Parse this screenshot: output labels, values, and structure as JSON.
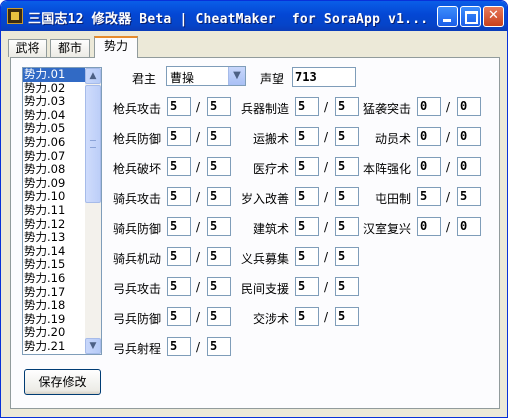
{
  "window": {
    "title": "三国志12 修改器 Beta | CheatMaker  for SoraApp v1...",
    "minimize_icon": "minimize-icon",
    "maximize_icon": "maximize-icon",
    "close_icon": "close-icon"
  },
  "tabs": [
    {
      "label": "武将"
    },
    {
      "label": "都市"
    },
    {
      "label": "势力",
      "active": true
    }
  ],
  "faction_list": {
    "items": [
      "势力.01",
      "势力.02",
      "势力.03",
      "势力.04",
      "势力.05",
      "势力.06",
      "势力.07",
      "势力.08",
      "势力.09",
      "势力.10",
      "势力.11",
      "势力.12",
      "势力.13",
      "势力.14",
      "势力.15",
      "势力.16",
      "势力.17",
      "势力.18",
      "势力.19",
      "势力.20",
      "势力.21"
    ],
    "selected_index": 0
  },
  "lord": {
    "label": "君主",
    "value": "曹操"
  },
  "fame": {
    "label": "声望",
    "value": "713"
  },
  "col1": [
    {
      "label": "枪兵攻击",
      "cur": "5",
      "max": "5"
    },
    {
      "label": "枪兵防御",
      "cur": "5",
      "max": "5"
    },
    {
      "label": "枪兵破坏",
      "cur": "5",
      "max": "5"
    },
    {
      "label": "骑兵攻击",
      "cur": "5",
      "max": "5"
    },
    {
      "label": "骑兵防御",
      "cur": "5",
      "max": "5"
    },
    {
      "label": "骑兵机动",
      "cur": "5",
      "max": "5"
    },
    {
      "label": "弓兵攻击",
      "cur": "5",
      "max": "5"
    },
    {
      "label": "弓兵防御",
      "cur": "5",
      "max": "5"
    },
    {
      "label": "弓兵射程",
      "cur": "5",
      "max": "5"
    }
  ],
  "col2": [
    {
      "label": "兵器制造",
      "cur": "5",
      "max": "5"
    },
    {
      "label": "运搬术",
      "cur": "5",
      "max": "5"
    },
    {
      "label": "医疗术",
      "cur": "5",
      "max": "5"
    },
    {
      "label": "岁入改善",
      "cur": "5",
      "max": "5"
    },
    {
      "label": "建筑术",
      "cur": "5",
      "max": "5"
    },
    {
      "label": "义兵募集",
      "cur": "5",
      "max": "5"
    },
    {
      "label": "民间支援",
      "cur": "5",
      "max": "5"
    },
    {
      "label": "交涉术",
      "cur": "5",
      "max": "5"
    }
  ],
  "col3": [
    {
      "label": "猛袭突击",
      "cur": "0",
      "max": "0"
    },
    {
      "label": "动员术",
      "cur": "0",
      "max": "0"
    },
    {
      "label": "本阵强化",
      "cur": "0",
      "max": "0"
    },
    {
      "label": "屯田制",
      "cur": "5",
      "max": "5"
    },
    {
      "label": "汉室复兴",
      "cur": "0",
      "max": "0"
    }
  ],
  "save_button": {
    "label": "保存修改"
  },
  "separator": "/",
  "scroll_up_icon": "▲",
  "scroll_down_icon": "▼",
  "dropdown_icon": "▼"
}
